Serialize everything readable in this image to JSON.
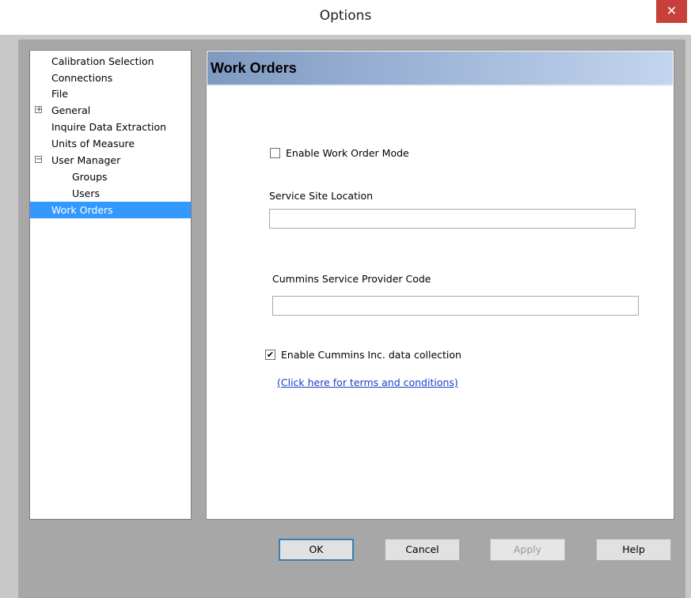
{
  "window": {
    "title": "Options",
    "close_glyph": "✕"
  },
  "tree": {
    "items": [
      {
        "label": "Calibration Selection"
      },
      {
        "label": "Connections"
      },
      {
        "label": "File"
      },
      {
        "label": "General",
        "expander": "+"
      },
      {
        "label": "Inquire Data Extraction"
      },
      {
        "label": "Units of Measure"
      },
      {
        "label": "User Manager",
        "expander": "−"
      },
      {
        "label": "Groups"
      },
      {
        "label": "Users"
      },
      {
        "label": "Work Orders",
        "selected": true
      }
    ]
  },
  "panel": {
    "header": "Work Orders",
    "enable_work_order": {
      "label": "Enable Work Order Mode",
      "checked": false
    },
    "service_site": {
      "label": "Service Site Location",
      "value": ""
    },
    "provider_code": {
      "label": "Cummins Service Provider Code",
      "value": ""
    },
    "data_collection": {
      "label": "Enable Cummins Inc. data collection",
      "checked": true,
      "check_glyph": "✔"
    },
    "terms_link": "(Click here for terms and conditions)"
  },
  "buttons": {
    "ok": "OK",
    "cancel": "Cancel",
    "apply": "Apply",
    "help": "Help"
  },
  "colors": {
    "selection": "#3399ff",
    "close_button": "#c7403a",
    "header_gradient_start": "#7f99c0",
    "header_gradient_end": "#c3d5ee",
    "link": "#1a3cc8"
  }
}
